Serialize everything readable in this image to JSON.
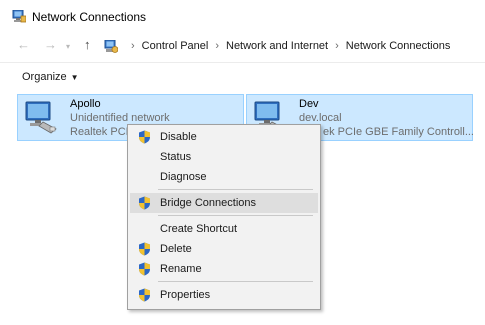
{
  "window": {
    "title": "Network Connections"
  },
  "addressbar": {
    "back_icon": "arrow-left-icon",
    "forward_icon": "arrow-right-icon",
    "recent_icon": "chevron-down-icon",
    "up_icon": "arrow-up-icon",
    "breadcrumb": [
      "Control Panel",
      "Network and Internet",
      "Network Connections"
    ],
    "separator": "›"
  },
  "toolbar": {
    "organize_label": "Organize",
    "organize_caret": "▼"
  },
  "connections": [
    {
      "name": "Apollo",
      "status": "Unidentified network",
      "adapter": "Realtek PCIe"
    },
    {
      "name": "Dev",
      "status": "dev.local",
      "adapter": "ek PCIe GBE Family Controll..."
    }
  ],
  "context_menu": {
    "items": [
      {
        "label": "Disable",
        "icon": "shield-icon"
      },
      {
        "label": "Status",
        "icon": ""
      },
      {
        "label": "Diagnose",
        "icon": ""
      },
      {
        "label": "Bridge Connections",
        "icon": "shield-icon",
        "highlighted": true
      },
      {
        "label": "Create Shortcut",
        "icon": ""
      },
      {
        "label": "Delete",
        "icon": "shield-icon"
      },
      {
        "label": "Rename",
        "icon": "shield-icon"
      },
      {
        "label": "Properties",
        "icon": "shield-icon"
      }
    ]
  },
  "colors": {
    "selection_bg": "#cce8ff",
    "selection_border": "#99d1ff",
    "menu_bg": "#f2f2f2",
    "menu_highlight": "#dedede"
  }
}
